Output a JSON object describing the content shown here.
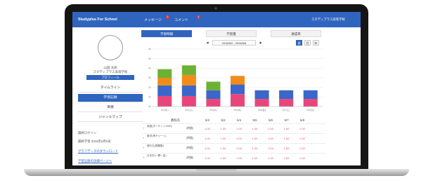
{
  "app": {
    "brand": "Studyplus For School",
    "nav": {
      "messages": "メッセージ",
      "comments": "コメント"
    },
    "badges": {
      "messages": "1",
      "comments": "1"
    },
    "school": "スタディプラス高等学校",
    "caret": "▼"
  },
  "sidebar": {
    "student_name": "山田 太郎",
    "student_school": "スタディプラス高等学校",
    "profile_button": "プロフィール",
    "menu": [
      "タイムライン",
      "学習記録",
      "目標",
      "ジャンルマップ"
    ],
    "active_menu_index": 1,
    "info_items": [
      "最終ログイン",
      "最終学習 2016年5月9日"
    ],
    "links": [
      "グラフデータのダウンロード",
      "学習記録の詳細ページへ"
    ]
  },
  "tabs": {
    "items": [
      "学習時間",
      "学習量",
      "達成率"
    ],
    "active_index": 0
  },
  "week_nav": {
    "prev": "◀",
    "range": "2016/5/2 - 2016/5/8",
    "next": "▶",
    "view_buttons": [
      "週",
      "月",
      "年"
    ],
    "active_view": 0
  },
  "colors": {
    "header": "#2f65bf",
    "accent": "#2f65bf",
    "series_pink": "#e8467b",
    "series_blue": "#3a67c9",
    "series_orange": "#f08c1a",
    "series_green": "#6bb234",
    "value_text": "#e0506c"
  },
  "chart_data": {
    "type": "bar",
    "stacked": true,
    "categories": [
      "5/2(月)",
      "5/3(火)",
      "5/4(水)",
      "5/5(木)",
      "5/6(金)",
      "5/7(土)",
      "5/8(日)"
    ],
    "y_ticks": [
      "6h",
      "5h",
      "4h",
      "3h",
      "2h",
      "1h",
      "0h"
    ],
    "ylim": [
      0,
      6
    ],
    "series": [
      {
        "color": "#e8467b",
        "values": [
          1.1,
          1.1,
          0.8,
          1.3,
          0.8,
          0.8,
          0.8
        ]
      },
      {
        "color": "#3a67c9",
        "values": [
          1.1,
          1.1,
          0.9,
          1.0,
          0.9,
          0.9,
          0.9
        ]
      },
      {
        "color": "#f08c1a",
        "values": [
          0.8,
          1.1,
          0,
          0.9,
          0,
          0,
          0
        ]
      },
      {
        "color": "#6bb234",
        "values": [
          0.9,
          1.0,
          0.9,
          0,
          0,
          0,
          0
        ]
      }
    ],
    "grid": true,
    "legend": "none"
  },
  "table": {
    "header_label": "教科名",
    "dates": [
      "5/2",
      "5/3",
      "5/4",
      "5/5",
      "5/6",
      "5/7",
      "5/8"
    ],
    "rows": [
      {
        "label": "英語(ターゲット1900)",
        "unit": "(時間)",
        "values": [
          "1.00",
          "1.00",
          "1.00",
          "1.00",
          "1.00",
          "1.00",
          "1.00"
        ]
      },
      {
        "label": "数学(青チャート)",
        "unit": "(時間)",
        "values": [
          "1.00",
          "1.00",
          "1.00",
          "1.00",
          "1.00",
          "1.00",
          "1.00"
        ]
      },
      {
        "label": "現代文(問題集)",
        "unit": "(時間)",
        "values": [
          "1.00",
          "1.00",
          "1.00",
          "1.00",
          "1.00",
          "1.00",
          "1.00"
        ]
      },
      {
        "label": "日本史(一問一答)",
        "unit": "(時間)",
        "values": [
          "1.00",
          "1.00",
          "1.00",
          "1.00",
          "1.00",
          "1.00",
          "1.00"
        ]
      }
    ]
  }
}
